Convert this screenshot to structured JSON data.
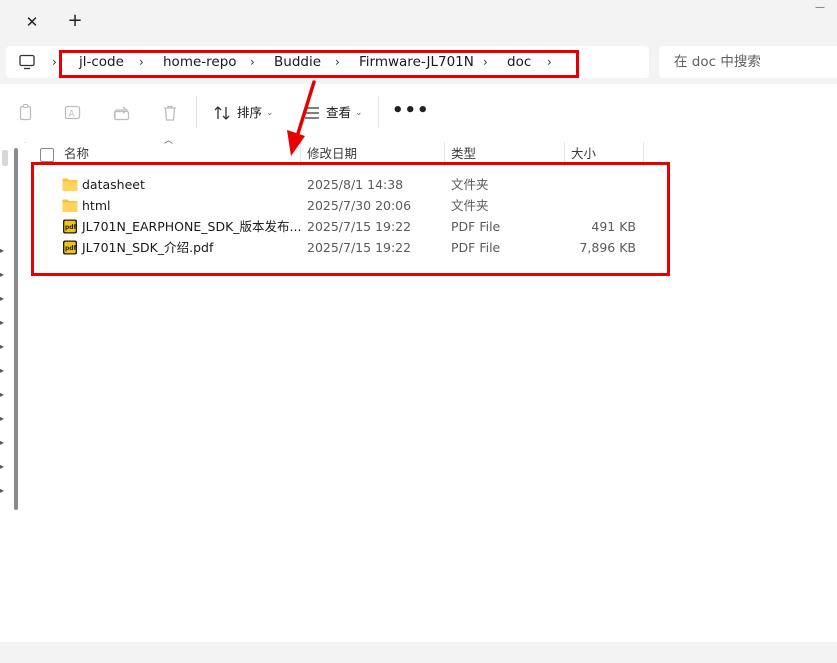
{
  "window": {
    "tab_close_glyph": "✕",
    "tab_new_glyph": "+",
    "minimize_glyph": "—"
  },
  "address_bar": {
    "crumbs": [
      "jl-code",
      "home-repo",
      "Buddie",
      "Firmware-JL701N",
      "doc"
    ],
    "separator": "›",
    "search_placeholder": "在 doc 中搜索"
  },
  "toolbar": {
    "sort_label": "排序",
    "view_label": "查看",
    "more_label": "•••",
    "icons": [
      "copy-icon",
      "rename-icon",
      "share-icon",
      "delete-icon",
      "sort-icon",
      "view-icon"
    ]
  },
  "columns": {
    "name": "名称",
    "date": "修改日期",
    "type": "类型",
    "size": "大小"
  },
  "files": [
    {
      "name": "datasheet",
      "date": "2025/8/1 14:38",
      "type": "文件夹",
      "size": "",
      "icon": "folder-icon"
    },
    {
      "name": "html",
      "date": "2025/7/30 20:06",
      "type": "文件夹",
      "size": "",
      "icon": "folder-icon"
    },
    {
      "name": "JL701N_EARPHONE_SDK_版本发布...",
      "date": "2025/7/15 19:22",
      "type": "PDF File",
      "size": "491 KB",
      "icon": "pdf-icon"
    },
    {
      "name": "JL701N_SDK_介绍.pdf",
      "date": "2025/7/15 19:22",
      "type": "PDF File",
      "size": "7,896 KB",
      "icon": "pdf-icon"
    }
  ],
  "colors": {
    "annotation": "#e60000",
    "folder": "#f5c23e",
    "pdf_badge": "#f1c40f",
    "chrome_bg": "#f3f3f3"
  }
}
